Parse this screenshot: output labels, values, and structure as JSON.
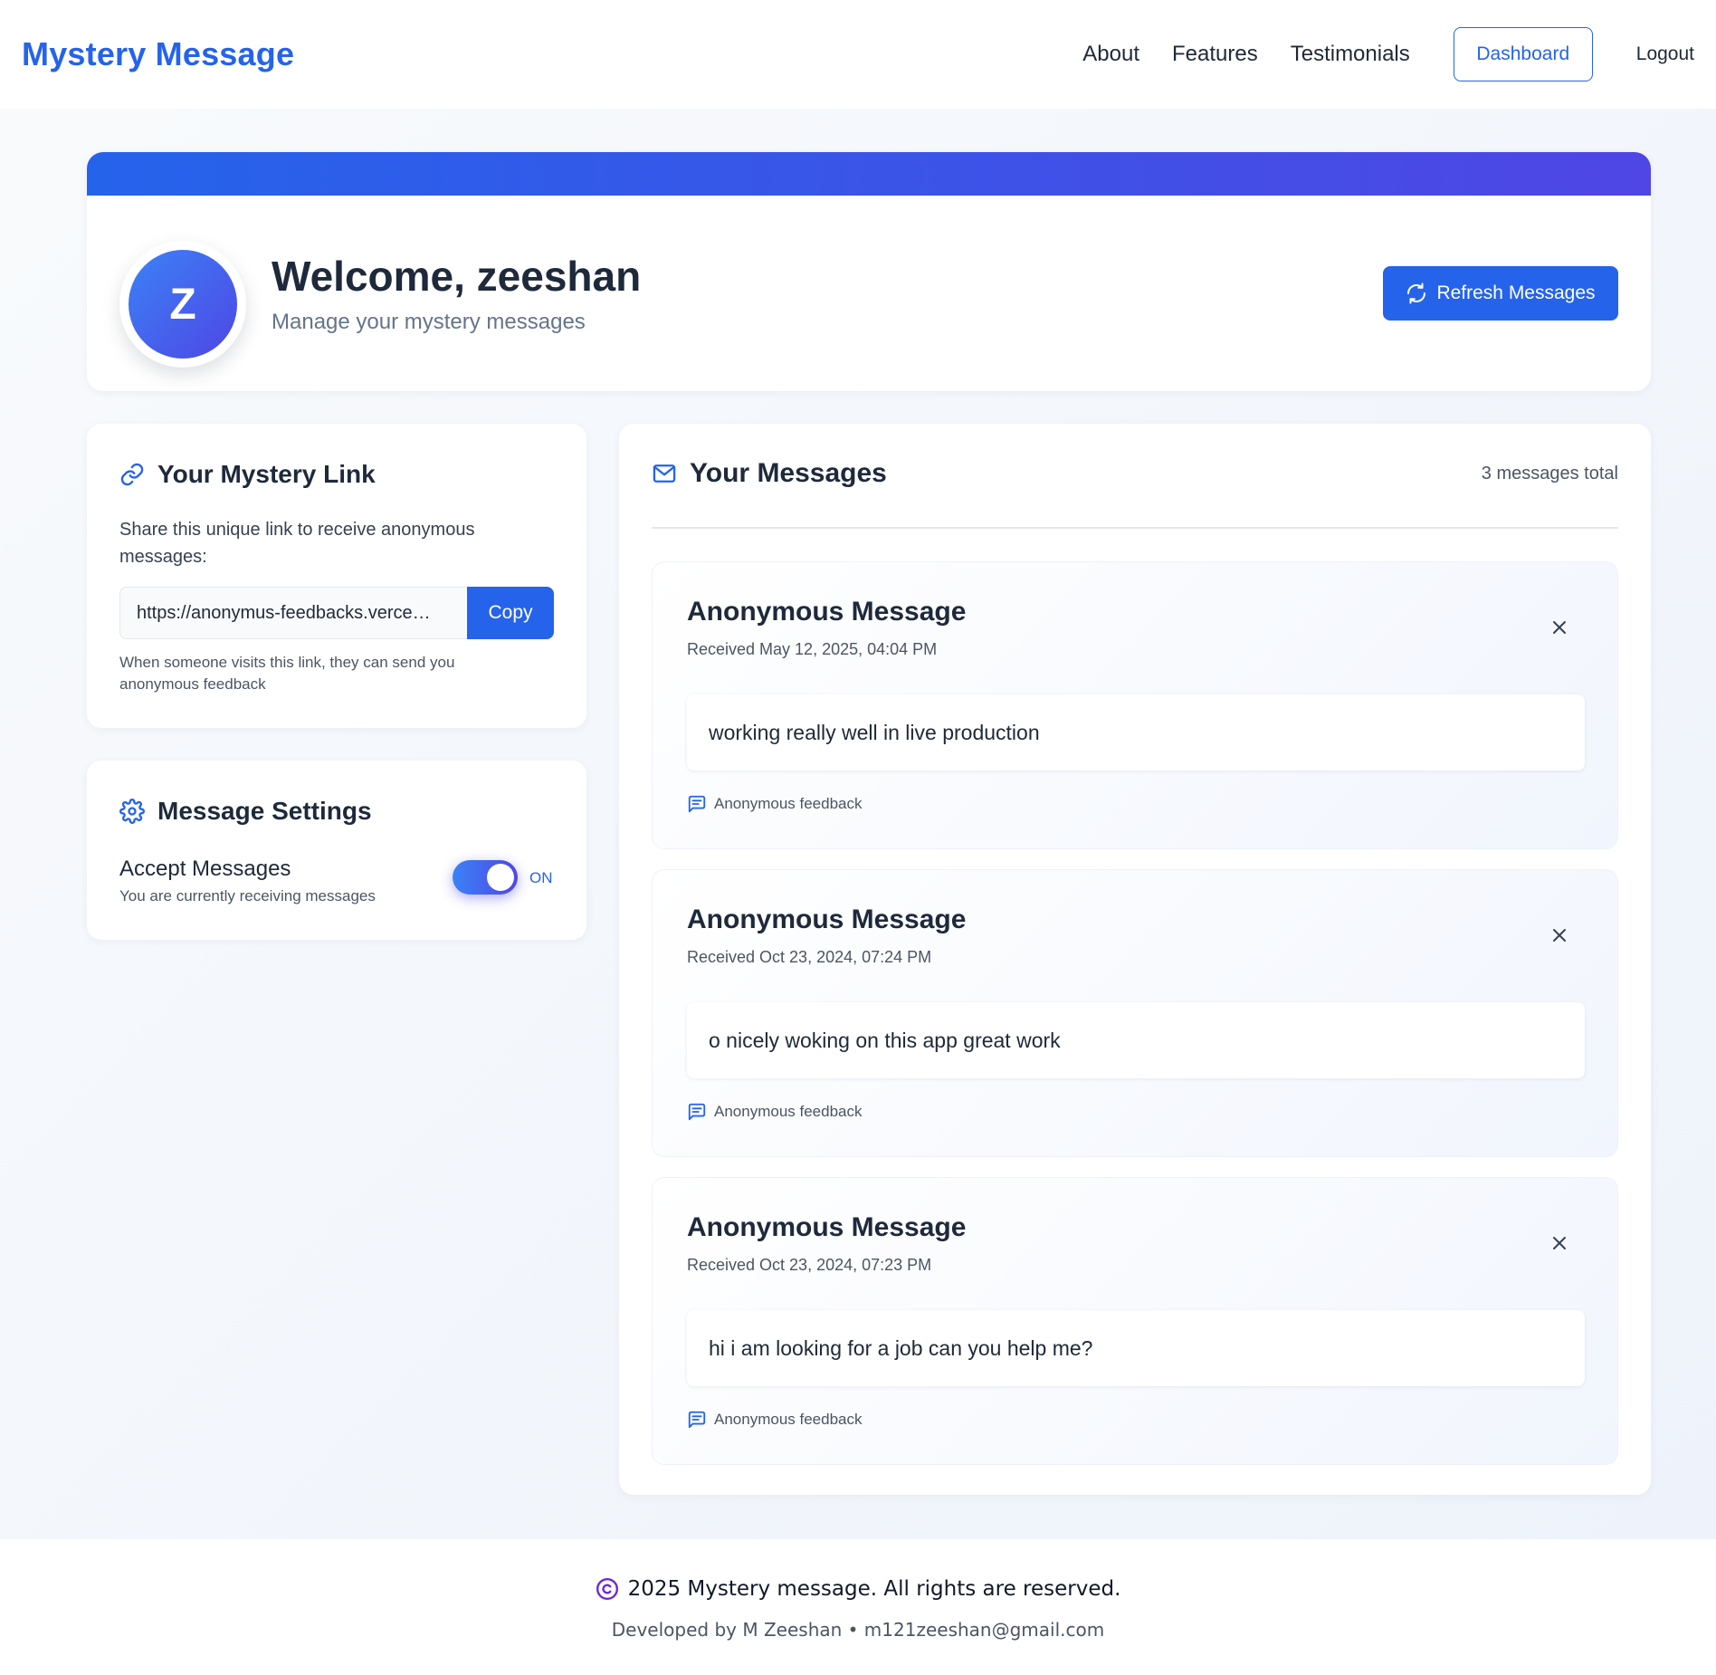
{
  "navbar": {
    "brand": "Mystery Message",
    "links": [
      "About",
      "Features",
      "Testimonials"
    ],
    "dashboard_label": "Dashboard",
    "logout_label": "Logout"
  },
  "welcome": {
    "avatar_letter": "Z",
    "title": "Welcome, zeeshan",
    "subtitle": "Manage your mystery messages",
    "refresh_label": "Refresh Messages"
  },
  "mystery_link": {
    "heading": "Your Mystery Link",
    "description": "Share this unique link to receive anonymous messages:",
    "url": "https://anonymus-feedbacks.verce…",
    "copy_label": "Copy",
    "help": "When someone visits this link, they can send you anonymous feedback"
  },
  "settings": {
    "heading": "Message Settings",
    "accept_label": "Accept Messages",
    "accept_sub": "You are currently receiving messages",
    "toggle_state": "ON",
    "accepting": true
  },
  "messages": {
    "heading": "Your Messages",
    "count_text": "3 messages total",
    "items": [
      {
        "title": "Anonymous Message",
        "date": "Received May 12, 2025, 04:04 PM",
        "body": "working really well in live production",
        "foot": "Anonymous feedback"
      },
      {
        "title": "Anonymous Message",
        "date": "Received Oct 23, 2024, 07:24 PM",
        "body": "o nicely woking on this app great work",
        "foot": "Anonymous feedback"
      },
      {
        "title": "Anonymous Message",
        "date": "Received Oct 23, 2024, 07:23 PM",
        "body": "hi i am looking for a job can you help me?",
        "foot": "Anonymous feedback"
      }
    ]
  },
  "footer": {
    "copyright": "2025 Mystery message. All rights are reserved.",
    "developer": "Developed by M Zeeshan • m121zeeshan@gmail.com"
  },
  "colors": {
    "accent": "#2563eb",
    "accent_secondary": "#4f46e5",
    "background": "#f3f6fb"
  },
  "icons": [
    "link-icon",
    "mail-icon",
    "gear-icon",
    "refresh-icon",
    "close-icon",
    "message-square-icon",
    "copyright-icon"
  ]
}
